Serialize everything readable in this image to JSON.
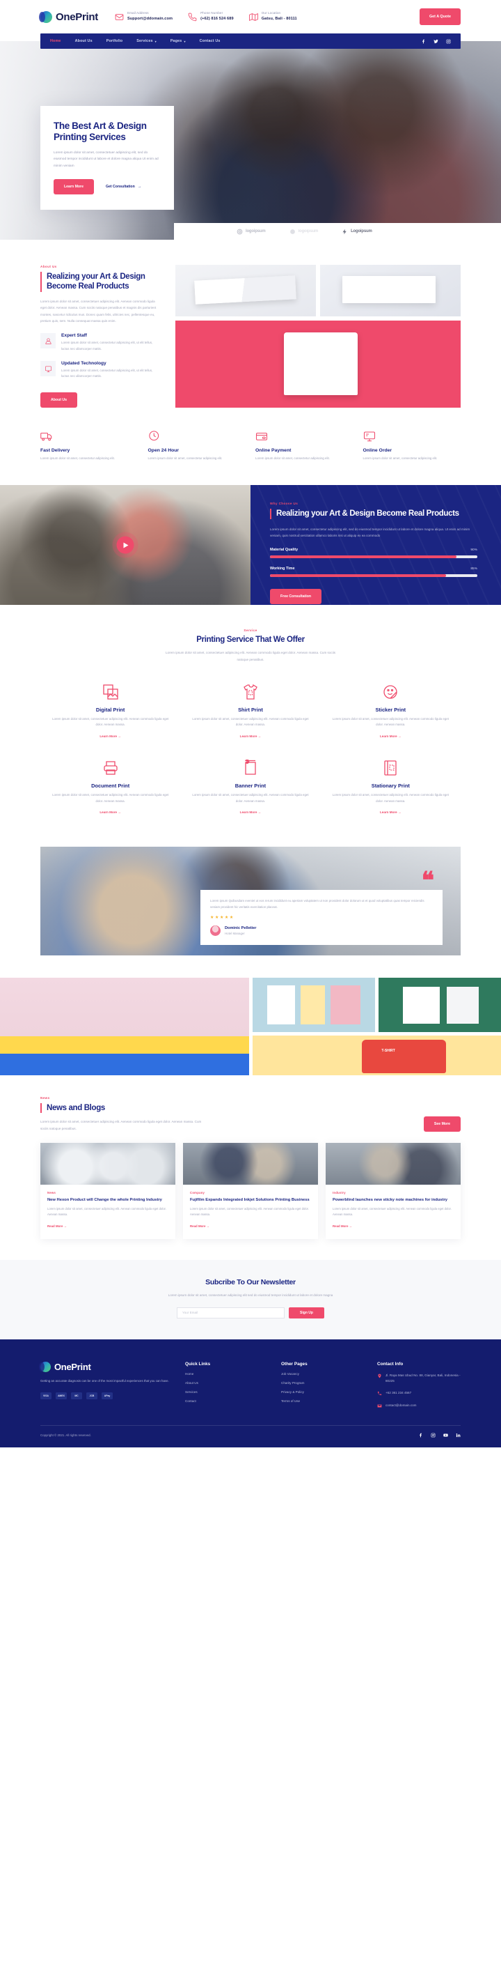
{
  "brand": {
    "name": "OnePrint"
  },
  "topbar": {
    "info": [
      {
        "icon": "envelope-icon",
        "label": "Email Address",
        "value": "Support@ddomain.com"
      },
      {
        "icon": "phone-icon",
        "label": "Phone Number",
        "value": "(+62) 816 524 689"
      },
      {
        "icon": "map-icon",
        "label": "Our Location",
        "value": "Gatsu, Bali - 80111"
      }
    ],
    "quote_button": "Get A Quote"
  },
  "nav": {
    "items": [
      {
        "label": "Home",
        "active": true,
        "caret": false
      },
      {
        "label": "About Us",
        "active": false,
        "caret": false
      },
      {
        "label": "Portfolio",
        "active": false,
        "caret": false
      },
      {
        "label": "Services",
        "active": false,
        "caret": true
      },
      {
        "label": "Pages",
        "active": false,
        "caret": true
      },
      {
        "label": "Contact Us",
        "active": false,
        "caret": false
      }
    ],
    "social": [
      "facebook-icon",
      "twitter-icon",
      "instagram-icon"
    ]
  },
  "hero": {
    "title": "The Best Art & Design Printing Services",
    "paragraph": "Lorem ipsum dolor sit amet, consectetuer adipiscing elit, sed do eiusmod tempor incididunt ut labore et dolore magna aliqua Ut enim ad minim veniam",
    "primary_button": "Learn More",
    "secondary_link": "Get Consultation",
    "logos": [
      {
        "text": "logoipsum",
        "style": "outline"
      },
      {
        "text": "logoipsum",
        "style": "dim"
      },
      {
        "text": "Logoipsum",
        "style": "dark"
      }
    ]
  },
  "about": {
    "eyebrow": "About Us",
    "title": "Realizing your Art & Design Become Real Products",
    "paragraph": "Lorem ipsum dolor sit amet, consectetuer adipiscing elit. Aenean commodo ligula eget dolor. Aenean massa. Cum sociis natoque penatibus et magnis dis parturient montes, nascetur ridiculus mus. Donec quam felis, ultricies nec, pellentesque eu, pretium quis, sem. Nulla consequat massa quis enim.",
    "features": [
      {
        "icon": "staff-icon",
        "title": "Expert Staff",
        "text": "Lorem ipsum dolor sit amet, consectetur adipiscing elit, ut elit tellus, luctus nec ullamcorper mattis."
      },
      {
        "icon": "tech-icon",
        "title": "Updated Technology",
        "text": "Lorem ipsum dolor sit amet, consectetur adipiscing elit, ut elit tellus, luctus nec ullamcorper mattis."
      }
    ],
    "button": "About Us"
  },
  "features": [
    {
      "icon": "truck-icon",
      "title": "Fast Delivery",
      "text": "Lorem ipsum dolor sit amet, consectetur adipiscing elit."
    },
    {
      "icon": "clock24-icon",
      "title": "Open 24 Hour",
      "text": "Lorem ipsum dolor sit amet, consectetur adipiscing elit."
    },
    {
      "icon": "card-icon",
      "title": "Online Payment",
      "text": "Lorem ipsum dolor sit amet, consectetur adipiscing elit."
    },
    {
      "icon": "monitor-icon",
      "title": "Online Order",
      "text": "Lorem ipsum dolor sit amet, consectetur adipiscing elit."
    }
  ],
  "why": {
    "eyebrow": "Why Choose Us",
    "title": "Realizing your Art & Design Become Real Products",
    "paragraph": "Lorem ipsum dolor sit amet, consectetur adipiscing elit, sed do eiusmod tempor incididunt ut labore et dolore magna aliqua. Ut enim ad minim veniam, quis nostrud xercitation ullamco laboris nisi ut aliquip ex ea commodo",
    "bars": [
      {
        "name": "Material Quality",
        "value": "90%",
        "pct": 90
      },
      {
        "name": "Working Time",
        "value": "85%",
        "pct": 85
      }
    ],
    "button": "Free Consultation",
    "play_icon": "play-icon"
  },
  "services": {
    "eyebrow": "Service",
    "title": "Printing Service That We Offer",
    "subtitle": "Lorem ipsum dolor sit amet, consectetuer adipiscing elit. Aenean commodo ligula eget dolor. Aenean massa. Cum sociis natoque penatibus.",
    "link_label": "Learn More",
    "items": [
      {
        "icon": "image-print-icon",
        "title": "Digital Print",
        "text": "Lorem ipsum dolor sit amet, consectetuer adipiscing elit. Aenean commodo ligula eget dolor. Aenean massa."
      },
      {
        "icon": "tshirt-icon",
        "title": "Shirt Print",
        "text": "Lorem ipsum dolor sit amet, consectetuer adipiscing elit. Aenean commodo ligula eget dolor. Aenean massa."
      },
      {
        "icon": "sticker-icon",
        "title": "Sticker Print",
        "text": "Lorem ipsum dolor sit amet, consectetuer adipiscing elit. Aenean commodo ligula eget dolor. Aenean massa."
      },
      {
        "icon": "printer-icon",
        "title": "Document Print",
        "text": "Lorem ipsum dolor sit amet, consectetuer adipiscing elit. Aenean commodo ligula eget dolor. Aenean massa."
      },
      {
        "icon": "banner-icon",
        "title": "Banner Print",
        "text": "Lorem ipsum dolor sit amet, consectetuer adipiscing elit. Aenean commodo ligula eget dolor. Aenean massa."
      },
      {
        "icon": "notebook-icon",
        "title": "Stationary Print",
        "text": "Lorem ipsum dolor sit amet, consectetuer adipiscing elit. Aenean commodo ligula eget dolor. Aenean massa."
      }
    ]
  },
  "testimonial": {
    "quote": "Lorem ipsum Quibusdam eveniet ut eos rerum incididunt eu aperiam voluptatem ut non provident dolor dolorum ut et quod voluptatibus quas tempor reiciendis veniam provident hic veritatis exercitation placeat.",
    "stars": "★★★★★",
    "name": "Dominic Pelletier",
    "role": "Hotel Manager",
    "quote_mark": "❝"
  },
  "news": {
    "eyebrow": "News",
    "title": "News and Blogs",
    "paragraph": "Lorem ipsum dolor sit amet, consectetuer adipiscing elit. Aenean commodo ligula eget dolor. Aenean massa. Cum sociis natoque penatibus.",
    "see_more": "See More",
    "read_more": "Read More",
    "posts": [
      {
        "category": "News",
        "title": "New Hexon Product will Change the whole Printing Industry",
        "text": "Lorem ipsum dolor sit amet, consectetuer adipiscing elit. Aenean commodo ligula eget dolor. Aenean massa."
      },
      {
        "category": "Company",
        "title": "Fujifilm Expands Integrated Inkjet Solutions Printing Business",
        "text": "Lorem ipsum dolor sit amet, consectetuer adipiscing elit. Aenean commodo ligula eget dolor. Aenean massa."
      },
      {
        "category": "Industry",
        "title": "Powerblind launches new sticky note machines for industry",
        "text": "Lorem ipsum dolor sit amet, consectetuer adipiscing elit. Aenean commodo ligula eget dolor. Aenean massa."
      }
    ]
  },
  "newsletter": {
    "title": "Subcribe To Our Newsletter",
    "paragraph": "Lorem ipsum dolor sit amet, consectetuer adipiscing elit sed do eiusmod tempor incididunt ut labore et dolore magna",
    "input_placeholder": "Your Email",
    "input_value": "",
    "button": "Sign Up"
  },
  "footer": {
    "about": "Getting an accurate diagnosis can be one of the most impactful experiences that you can have.",
    "payments": [
      "VISA",
      "AMEX",
      "MC",
      "JCB",
      "APay"
    ],
    "quick_links": {
      "title": "Quick Links",
      "items": [
        "Home",
        "About Us",
        "Services",
        "Contact"
      ]
    },
    "other_pages": {
      "title": "Other Pages",
      "items": [
        "Job Vacancy",
        "Charity Program",
        "Privacy & Policy",
        "Terms of Use"
      ]
    },
    "contact": {
      "title": "Contact Info",
      "items": [
        {
          "icon": "pin-icon",
          "text": "Jl. Raya Mas Ubud No. 88, Gianyar, Bali, Indonesia - 80225"
        },
        {
          "icon": "phone-icon",
          "text": "+62 361 234 4567"
        },
        {
          "icon": "envelope-icon",
          "text": "contact@domain.com"
        }
      ]
    },
    "copyright": "Copyright © 2021. All rights reserved.",
    "social": [
      "facebook-icon",
      "instagram-icon",
      "youtube-icon",
      "linkedin-icon"
    ]
  },
  "colors": {
    "primary": "#1b2582",
    "accent": "#ef4a6b",
    "footer": "#141c6e",
    "star": "#f6b42c"
  }
}
